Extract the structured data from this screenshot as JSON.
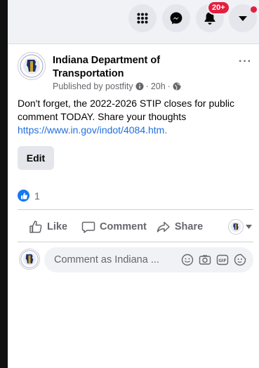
{
  "topbar": {
    "menu_icon": "grid-menu-icon",
    "messenger_icon": "messenger-icon",
    "notifications_icon": "bell-icon",
    "notifications_badge": "20+",
    "account_icon": "caret-down-icon"
  },
  "post": {
    "page_name": "Indiana Department of Transportation",
    "published_by": "Published by postfity",
    "time": "20h",
    "separator": "·",
    "more_label": "···",
    "text": "Don't forget, the 2022-2026 STIP closes for public comment TODAY. Share your thoughts",
    "link": "https://www.in.gov/indot/4084.htm",
    "link_suffix": ".",
    "edit_label": "Edit",
    "reaction_count": "1"
  },
  "actions": {
    "like_label": "Like",
    "comment_label": "Comment",
    "share_label": "Share"
  },
  "comment_box": {
    "placeholder": "Comment as Indiana ...",
    "icons": [
      "emoji-icon",
      "camera-icon",
      "gif-icon",
      "sticker-icon"
    ]
  },
  "colors": {
    "brand_blue": "#1877f2",
    "link": "#216fdb",
    "badge_red": "#e41e3f"
  }
}
